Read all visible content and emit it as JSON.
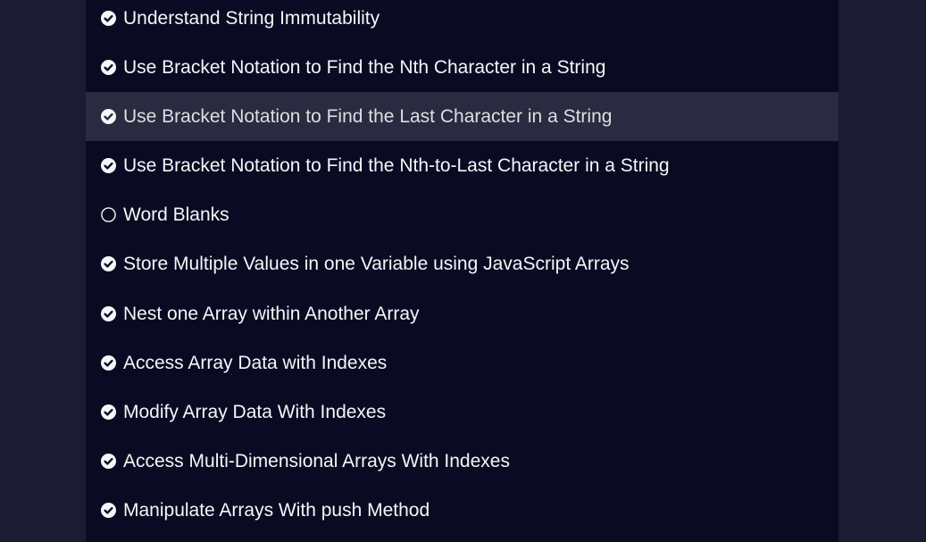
{
  "challenges": [
    {
      "title": "Understand String Immutability",
      "status": "completed",
      "icon": "check-circle-icon",
      "active": false
    },
    {
      "title": "Use Bracket Notation to Find the Nth Character in a String",
      "status": "completed",
      "icon": "check-circle-icon",
      "active": false
    },
    {
      "title": "Use Bracket Notation to Find the Last Character in a String",
      "status": "completed",
      "icon": "check-circle-icon",
      "active": true
    },
    {
      "title": "Use Bracket Notation to Find the Nth-to-Last Character in a String",
      "status": "completed",
      "icon": "check-circle-icon",
      "active": false
    },
    {
      "title": "Word Blanks",
      "status": "incomplete",
      "icon": "empty-circle-icon",
      "active": false
    },
    {
      "title": "Store Multiple Values in one Variable using JavaScript Arrays",
      "status": "completed",
      "icon": "check-circle-icon",
      "active": false
    },
    {
      "title": "Nest one Array within Another Array",
      "status": "completed",
      "icon": "check-circle-icon",
      "active": false
    },
    {
      "title": "Access Array Data with Indexes",
      "status": "completed",
      "icon": "check-circle-icon",
      "active": false
    },
    {
      "title": "Modify Array Data With Indexes",
      "status": "completed",
      "icon": "check-circle-icon",
      "active": false
    },
    {
      "title": "Access Multi-Dimensional Arrays With Indexes",
      "status": "completed",
      "icon": "check-circle-icon",
      "active": false
    },
    {
      "title": "Manipulate Arrays With push Method",
      "status": "completed",
      "icon": "check-circle-icon",
      "active": false
    }
  ],
  "colors": {
    "page_background": "#1b1b32",
    "panel_background": "#0a0a23",
    "active_row": "#2a2a40",
    "text": "#f5f6f7"
  }
}
